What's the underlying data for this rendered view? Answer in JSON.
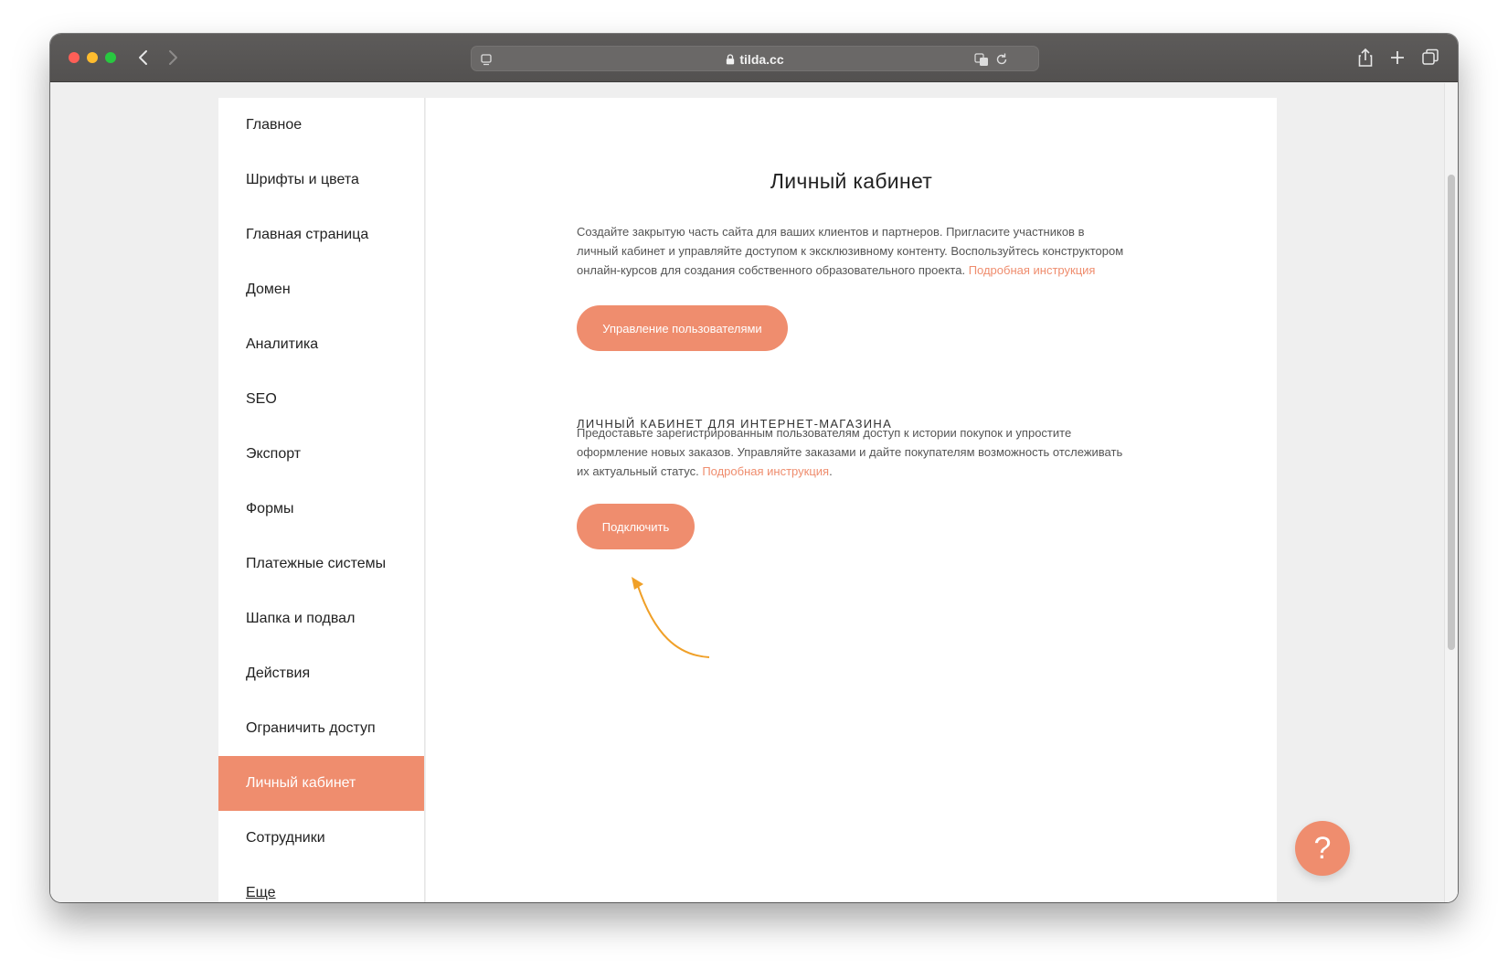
{
  "browser": {
    "url": "tilda.cc",
    "icons": [
      "sidebar-icon",
      "lock-icon",
      "translate-icon",
      "reload-icon",
      "share-icon",
      "plus-icon",
      "tabs-icon"
    ]
  },
  "sidebar": {
    "items": [
      {
        "label": "Главное"
      },
      {
        "label": "Шрифты и цвета"
      },
      {
        "label": "Главная страница"
      },
      {
        "label": "Домен"
      },
      {
        "label": "Аналитика"
      },
      {
        "label": "SEO"
      },
      {
        "label": "Экспорт"
      },
      {
        "label": "Формы"
      },
      {
        "label": "Платежные системы"
      },
      {
        "label": "Шапка и подвал"
      },
      {
        "label": "Действия"
      },
      {
        "label": "Ограничить доступ"
      },
      {
        "label": "Личный кабинет"
      },
      {
        "label": "Сотрудники"
      },
      {
        "label": "Еще"
      }
    ],
    "active_index": 12
  },
  "main": {
    "title": "Личный кабинет",
    "intro": {
      "text": "Создайте закрытую часть сайта для ваших клиентов и партнеров. Пригласите участников в личный кабинет и управляйте доступом к эксклюзивному контенту. Воспользуйтесь конструктором онлайн-курсов для создания собственного образовательного проекта. ",
      "link": "Подробная инструкция"
    },
    "manage_users_button": "Управление пользователями",
    "shop_section": {
      "heading": "ЛИЧНЫЙ КАБИНЕТ ДЛЯ ИНТЕРНЕТ-МАГАЗИНА",
      "text": "Предоставьте зарегистрированным пользователям доступ к истории покупок и упростите оформление новых заказов. Управляйте заказами и дайте покупателям возможность отслеживать их актуальный статус. ",
      "link": "Подробная инструкция",
      "link_suffix": ".",
      "connect_button": "Подключить"
    },
    "help_button": "?"
  },
  "colors": {
    "accent": "#ef8d6e",
    "arrow": "#f0a028"
  }
}
